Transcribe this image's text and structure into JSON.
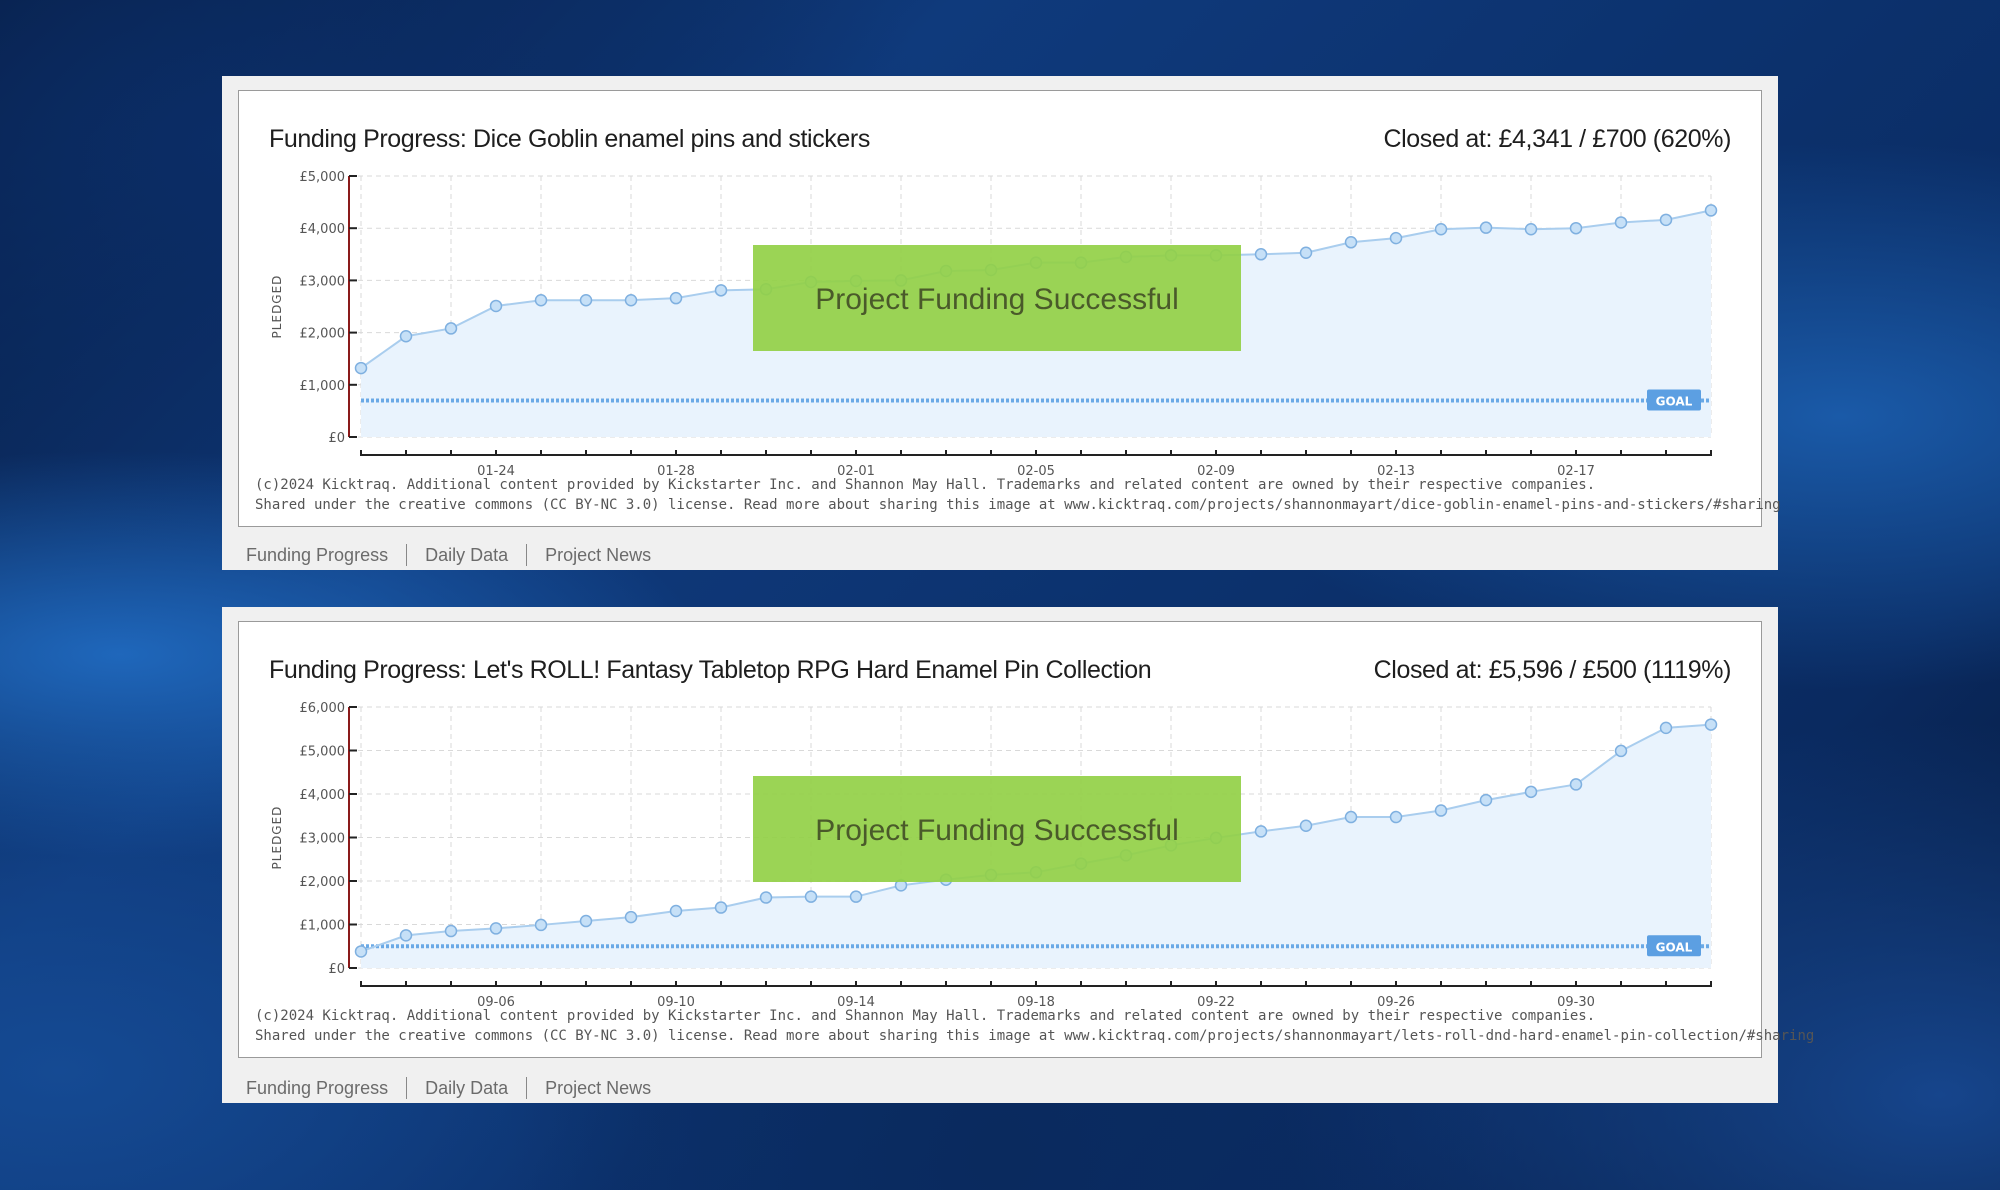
{
  "widgets": [
    {
      "title": "Funding Progress: Dice Goblin enamel pins and stickers",
      "closed": "Closed at: £4,341 / £700 (620%)",
      "banner": "Project Funding Successful",
      "goal_label": "GOAL",
      "ylabel": "PLEDGED",
      "copyright_1": "(c)2024 Kicktraq. Additional content provided by Kickstarter Inc. and Shannon May Hall. Trademarks and related content are owned by their respective companies.",
      "copyright_2": "Shared under the creative commons (CC BY-NC 3.0) license. Read more about sharing this image at www.kicktraq.com/projects/shannonmayart/dice-goblin-enamel-pins-and-stickers/#sharing",
      "tabs": [
        "Funding Progress",
        "Daily Data",
        "Project News"
      ]
    },
    {
      "title": "Funding Progress: Let's ROLL! Fantasy Tabletop RPG Hard Enamel Pin Collection",
      "closed": "Closed at: £5,596 / £500 (1119%)",
      "banner": "Project Funding Successful",
      "goal_label": "GOAL",
      "ylabel": "PLEDGED",
      "copyright_1": "(c)2024 Kicktraq. Additional content provided by Kickstarter Inc. and Shannon May Hall. Trademarks and related content are owned by their respective companies.",
      "copyright_2": "Shared under the creative commons (CC BY-NC 3.0) license. Read more about sharing this image at www.kicktraq.com/projects/shannonmayart/lets-roll-dnd-hard-enamel-pin-collection/#sharing",
      "tabs": [
        "Funding Progress",
        "Daily Data",
        "Project News"
      ]
    }
  ],
  "colors": {
    "line": "#a9cdee",
    "point_fill": "#c6e0f7",
    "point_stroke": "#7fb0e0",
    "area": "#e9f3fd",
    "goal": "#6aa9e6",
    "goal_badge": "#5c9fe2",
    "banner": "#92d046",
    "axis": "#222222"
  },
  "chart_data": [
    {
      "type": "line",
      "ylabel": "PLEDGED",
      "ylim": [
        0,
        5000
      ],
      "yticks": [
        "£0",
        "£1,000",
        "£2,000",
        "£3,000",
        "£4,000",
        "£5,000"
      ],
      "xticks": [
        "01-24",
        "01-28",
        "02-01",
        "02-05",
        "02-09",
        "02-13",
        "02-17"
      ],
      "goal": 700,
      "series": [
        {
          "values": [
            1320,
            1930,
            2080,
            2510,
            2620,
            2620,
            2620,
            2660,
            2810,
            2830,
            2970,
            2990,
            3000,
            3180,
            3200,
            3340,
            3340,
            3450,
            3480,
            3480,
            3500,
            3530,
            3730,
            3810,
            3980,
            4010,
            3980,
            4000,
            4110,
            4160,
            4341
          ]
        }
      ],
      "grid": true,
      "area_fill": true
    },
    {
      "type": "line",
      "ylabel": "PLEDGED",
      "ylim": [
        0,
        6000
      ],
      "yticks": [
        "£0",
        "£1,000",
        "£2,000",
        "£3,000",
        "£4,000",
        "£5,000",
        "£6,000"
      ],
      "xticks": [
        "09-06",
        "09-10",
        "09-14",
        "09-18",
        "09-22",
        "09-26",
        "09-30"
      ],
      "goal": 500,
      "series": [
        {
          "values": [
            380,
            750,
            850,
            910,
            990,
            1080,
            1170,
            1310,
            1390,
            1620,
            1640,
            1640,
            1900,
            2030,
            2140,
            2200,
            2400,
            2590,
            2820,
            2990,
            3140,
            3270,
            3470,
            3470,
            3620,
            3860,
            4050,
            4220,
            4990,
            5520,
            5596
          ]
        }
      ],
      "grid": true,
      "area_fill": true
    }
  ]
}
